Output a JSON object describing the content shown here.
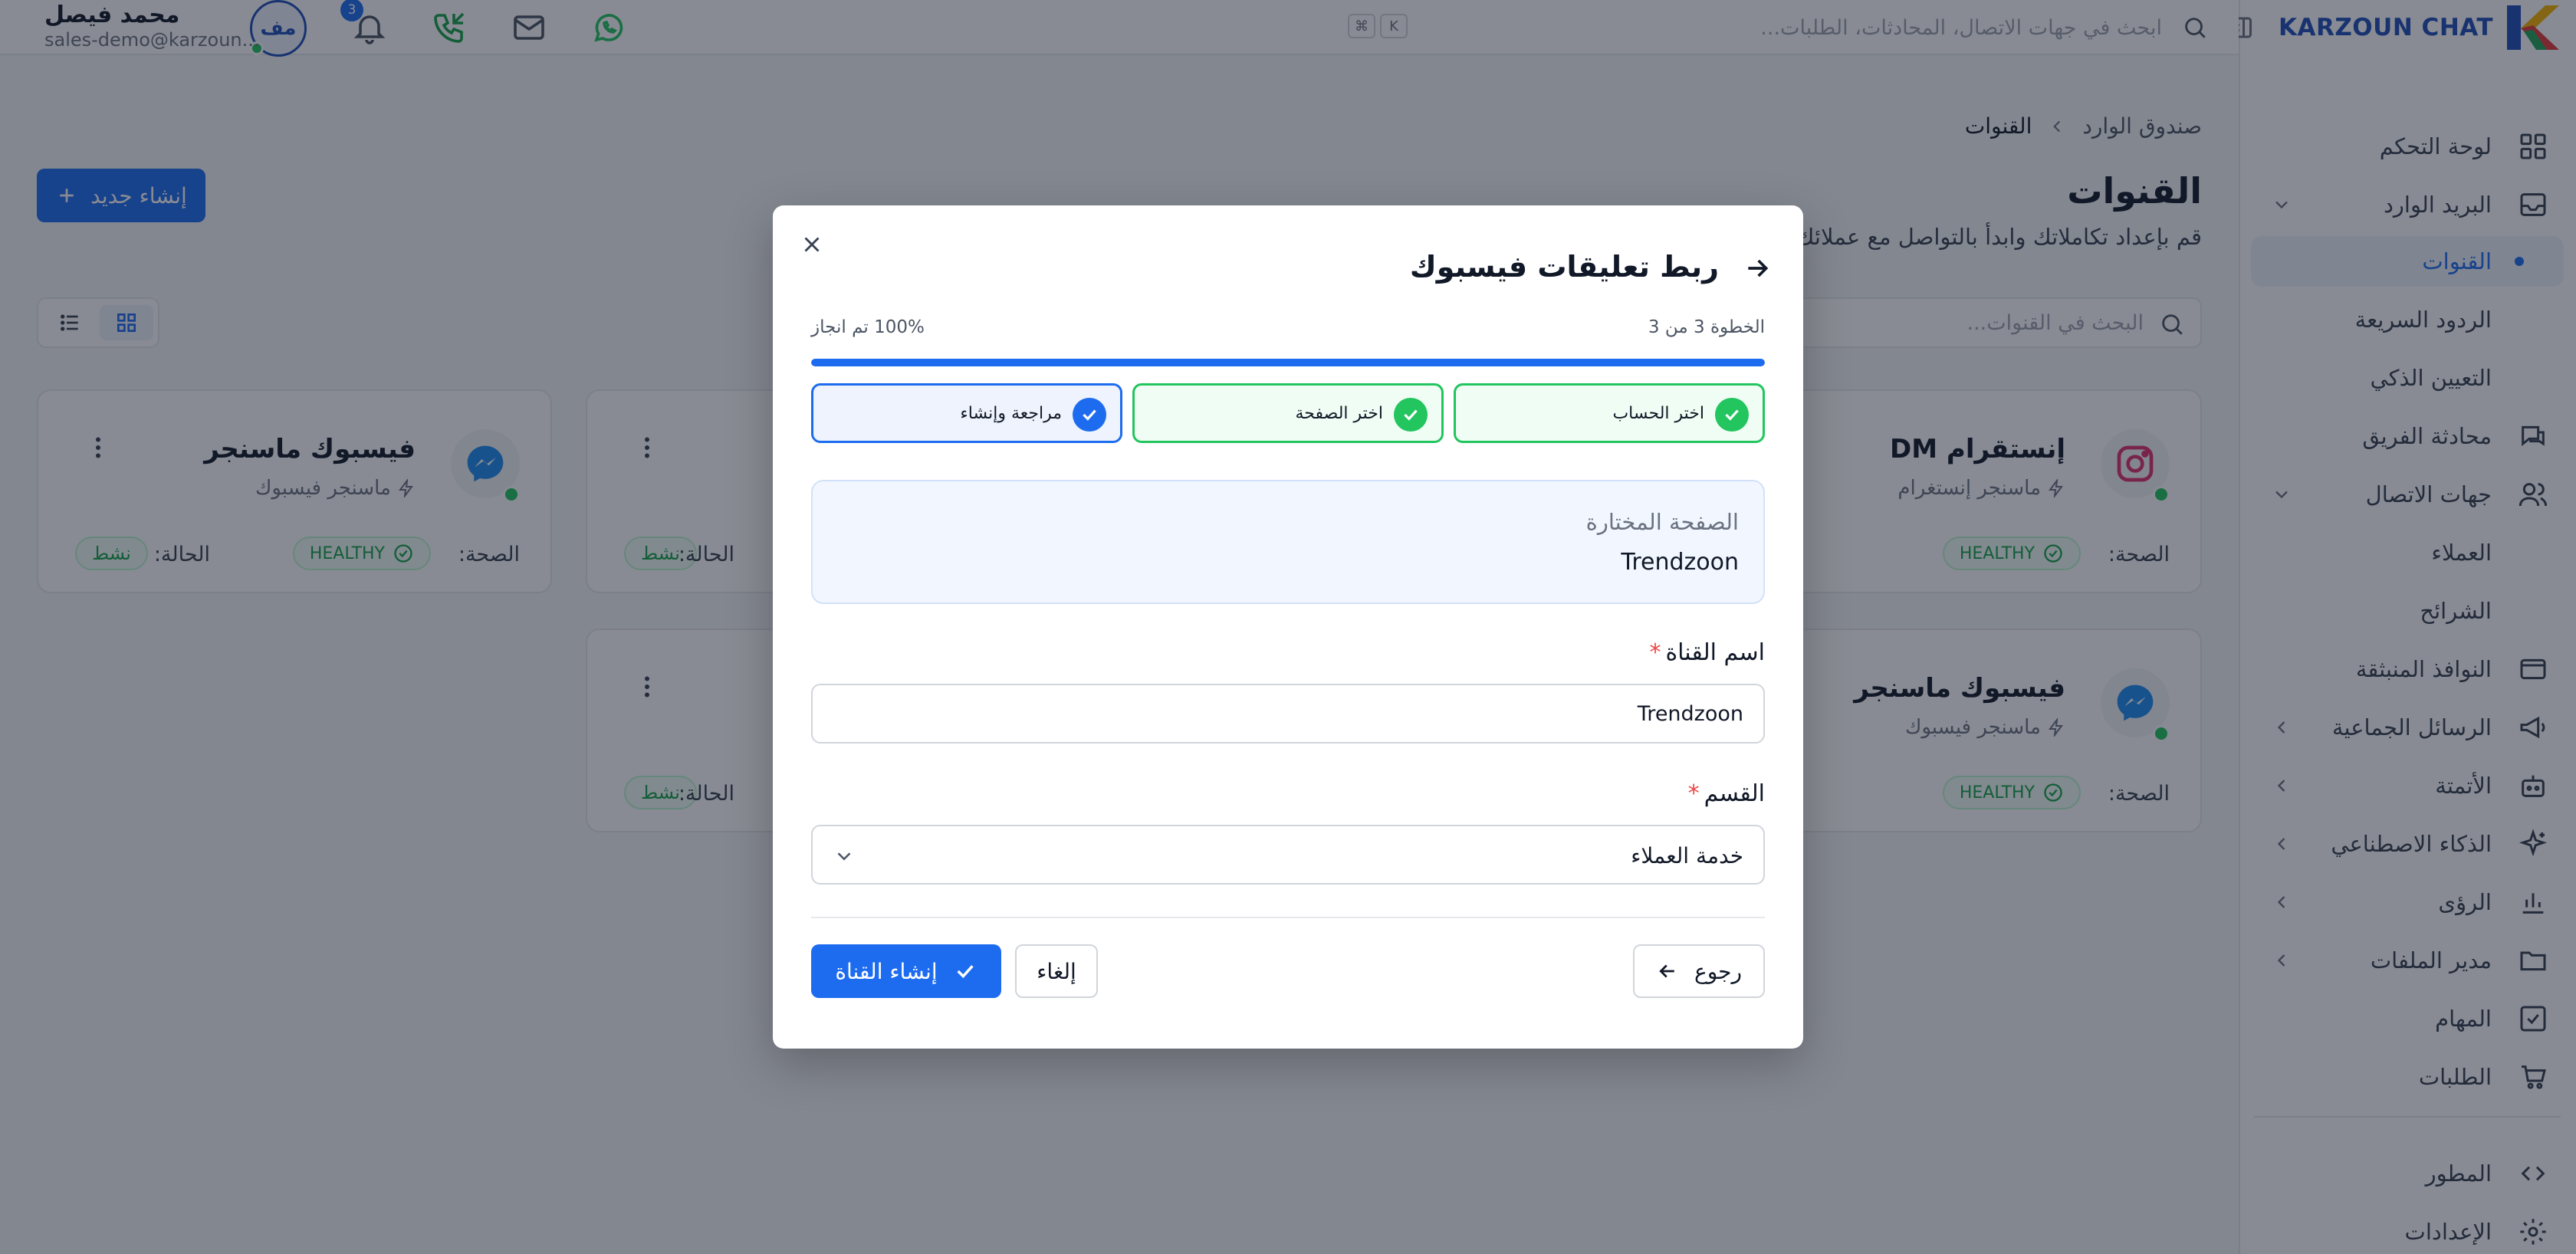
{
  "brand": {
    "name": "KARZOUN CHAT"
  },
  "sidebar": {
    "items": [
      {
        "label": "لوحة التحكم",
        "icon": "grid-icon"
      },
      {
        "label": "البريد الوارد",
        "icon": "inbox-icon"
      },
      {
        "label": "القنوات"
      },
      {
        "label": "الردود السريعة"
      },
      {
        "label": "التعيين الذكي"
      },
      {
        "label": "محادثة الفريق",
        "icon": "chat-icon"
      },
      {
        "label": "جهات الاتصال",
        "icon": "users-icon"
      },
      {
        "label": "العملاء"
      },
      {
        "label": "الشرائح"
      },
      {
        "label": "النوافذ المنبثقة",
        "icon": "window-icon"
      },
      {
        "label": "الرسائل الجماعية",
        "icon": "megaphone-icon"
      },
      {
        "label": "الأتمتة",
        "icon": "bot-icon"
      },
      {
        "label": "الذكاء الاصطناعي",
        "icon": "sparkle-icon"
      },
      {
        "label": "الرؤى",
        "icon": "chart-icon"
      },
      {
        "label": "مدير الملفات",
        "icon": "folder-icon"
      },
      {
        "label": "المهام",
        "icon": "checkbox-icon"
      },
      {
        "label": "الطلبات",
        "icon": "cart-icon"
      },
      {
        "label": "المطور",
        "icon": "code-icon"
      },
      {
        "label": "الإعدادات",
        "icon": "gear-icon"
      }
    ]
  },
  "topbar": {
    "search_placeholder": "ابحث في جهات الاتصال، المحادثات، الطلبات...",
    "kbd": [
      "K",
      "⌘"
    ],
    "notification_count": "3",
    "user": {
      "initials": "مف",
      "name": "محمد فيصل",
      "email": "sales-demo@karzoun..."
    }
  },
  "page": {
    "breadcrumb": [
      "صندوق الوارد",
      "القنوات"
    ],
    "title": "القنوات",
    "subtitle": "قم بإعداد تكاملاتك وابدأ بالتواصل مع عملائك",
    "create_label": "إنشاء جديد",
    "search_placeholder": "البحث في القنوات..."
  },
  "cards": {
    "health_label": "الصحة:",
    "health_value": "HEALTHY",
    "status_label": "الحالة:",
    "status_value": "نشط",
    "list": [
      {
        "name": "إنستقرام DM",
        "type": "ماسنجر إنستغرام"
      },
      {
        "name": "فيسبوك ماسنجر",
        "type": "ماسنجر فيسبوك"
      },
      {
        "name": "فيسبوك ماسنجر",
        "type": "ماسنجر فيسبوك"
      }
    ]
  },
  "modal": {
    "title": "ربط تعليقات فيسبوك",
    "step_text": "الخطوة 3 من 3",
    "progress_text": "100% تم انجاز",
    "progress": 1.0,
    "steps": [
      {
        "label": "اختر الحساب",
        "state": "done"
      },
      {
        "label": "اختر الصفحة",
        "state": "done"
      },
      {
        "label": "مراجعة وإنشاء",
        "state": "current"
      }
    ],
    "selected_page_label": "الصفحة المختارة",
    "selected_page_value": "Trendzoon",
    "channel_name_label": "اسم القناة",
    "channel_name_value": "Trendzoon",
    "department_label": "القسم",
    "department_value": "خدمة العملاء",
    "required_mark": "*",
    "back_label": "رجوع",
    "cancel_label": "إلغاء",
    "create_label": "إنشاء القناة"
  },
  "colors": {
    "primary": "#1d6cf0",
    "success": "#22c55e",
    "brand": "#1f4fb8"
  }
}
